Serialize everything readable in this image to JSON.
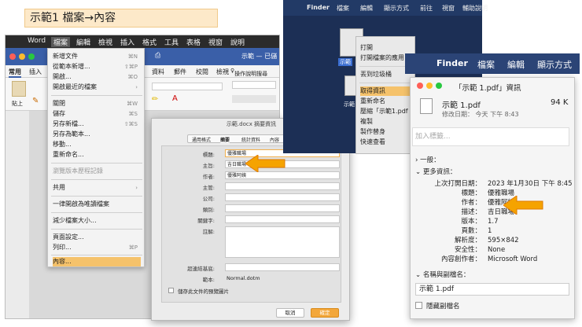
{
  "slide_title": "示範1 檔案→內容",
  "word": {
    "app_menu": [
      "Word",
      "檔案",
      "編輯",
      "檢視",
      "插入",
      "格式",
      "工具",
      "表格",
      "視窗",
      "說明"
    ],
    "ribbon_tabs": [
      "常用",
      "插入",
      "資料",
      "郵件",
      "校閱",
      "檢視"
    ],
    "doc_title": "示範 — 已儲",
    "tell_me": "操作說明搜尋",
    "paste_label": "貼上",
    "file_menu": [
      {
        "label": "新增文件",
        "shortcut": "⌘N"
      },
      {
        "label": "從範本新增...",
        "shortcut": "⇧⌘P"
      },
      {
        "label": "開啟...",
        "shortcut": "⌘O"
      },
      {
        "label": "開啟最近的檔案",
        "shortcut": "›"
      },
      {
        "label": "關閉",
        "shortcut": "⌘W"
      },
      {
        "label": "儲存",
        "shortcut": "⌘S"
      },
      {
        "label": "另存新檔...",
        "shortcut": "⇧⌘S"
      },
      {
        "label": "另存為範本...",
        "shortcut": ""
      },
      {
        "label": "移動...",
        "shortcut": ""
      },
      {
        "label": "重新命名...",
        "shortcut": ""
      },
      {
        "label": "瀏覽版本歷程記錄",
        "shortcut": ""
      },
      {
        "label": "共用",
        "shortcut": "›"
      },
      {
        "label": "一律開啟為唯讀檔案",
        "shortcut": ""
      },
      {
        "label": "減少檔案大小...",
        "shortcut": ""
      },
      {
        "label": "頁面設定...",
        "shortcut": ""
      },
      {
        "label": "列印...",
        "shortcut": "⌘P"
      },
      {
        "label": "內容...",
        "shortcut": ""
      }
    ]
  },
  "dialog": {
    "title": "示範.docx 摘要資訊",
    "tabs": [
      "通用格式",
      "摘要",
      "統計資料",
      "內容",
      "自訂"
    ],
    "fields": [
      {
        "label": "標題:",
        "value": "優雅職場"
      },
      {
        "label": "主旨:",
        "value": "吉日職場"
      },
      {
        "label": "作者:",
        "value": "優雅阿姨"
      },
      {
        "label": "主管:",
        "value": ""
      },
      {
        "label": "公司:",
        "value": ""
      },
      {
        "label": "類別:",
        "value": ""
      },
      {
        "label": "關鍵字:",
        "value": ""
      },
      {
        "label": "註解:",
        "value": ""
      }
    ],
    "hyperlink_base_label": "超連結基底:",
    "template_label": "範本:",
    "template_value": "Normal.dotm",
    "checkbox_label": "儲存此文件的預覽圖片",
    "cancel": "取消",
    "ok": "確定"
  },
  "finder": {
    "menubar": [
      "Finder",
      "檔案",
      "編輯",
      "顯示方式",
      "前往",
      "視窗",
      "輔助說明"
    ],
    "file_label": "示範",
    "file_label2": "示範",
    "context_menu": [
      "打開",
      "打開檔案的應用",
      "丟到垃圾桶",
      "取得資訊",
      "重新命名",
      "壓縮「示範1.pdf",
      "複製",
      "製作替身",
      "快速查看"
    ]
  },
  "info": {
    "menubar": [
      "Finder",
      "檔案",
      "編輯",
      "顯示方式"
    ],
    "window_title": "「示範 1.pdf」資訊",
    "file_name": "示範 1.pdf",
    "file_size": "94 K",
    "modified": "修改日期： 今天 下午 8:43",
    "tags_placeholder": "加入標籤...",
    "general_label": "一般：",
    "more_info_label": "更多資訊：",
    "details": [
      {
        "key": "上次打開日期：",
        "value": "2023 年1月30日 下午 8:45"
      },
      {
        "key": "標題：",
        "value": "優雅職場"
      },
      {
        "key": "作者：",
        "value": "優雅阿姨"
      },
      {
        "key": "描述：",
        "value": "吉日職場"
      },
      {
        "key": "版本：",
        "value": "1.7"
      },
      {
        "key": "頁數：",
        "value": "1"
      },
      {
        "key": "解析度：",
        "value": "595×842"
      },
      {
        "key": "安全性：",
        "value": "None"
      },
      {
        "key": "內容創作者：",
        "value": "Microsoft Word"
      }
    ],
    "name_ext_label": "名稱與副檔名：",
    "name_value": "示範 1.pdf",
    "hide_ext_label": "隱藏副檔名"
  },
  "colors": {
    "accent": "#f5a300",
    "highlight": "#f5c26b",
    "word_blue": "#3a5fa8"
  }
}
